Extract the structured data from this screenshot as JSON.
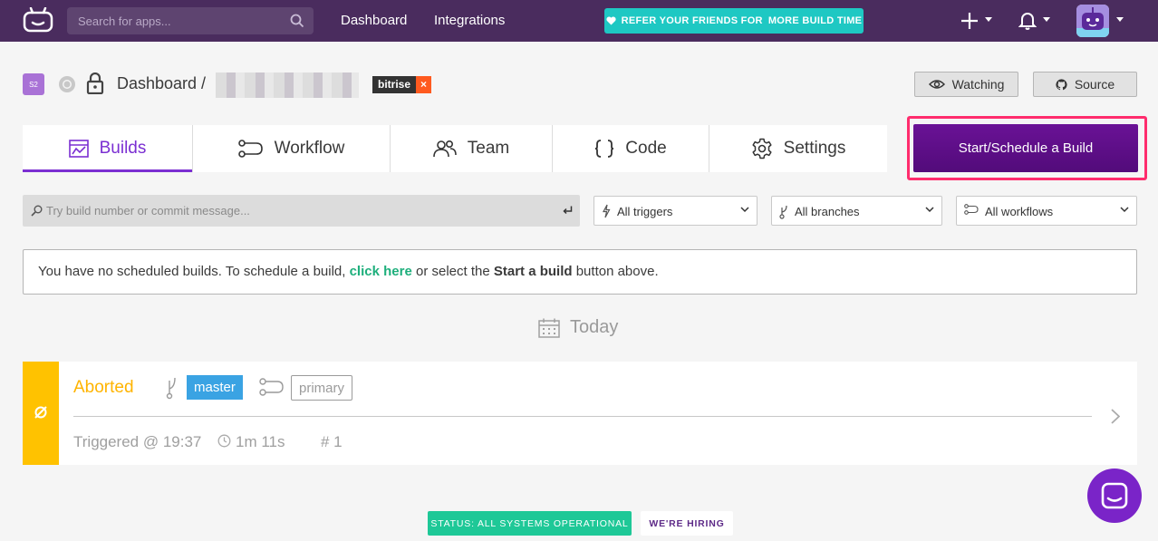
{
  "topnav": {
    "search_placeholder": "Search for apps...",
    "links": [
      "Dashboard",
      "Integrations"
    ],
    "refer_prefix": "REFER YOUR FRIENDS FOR",
    "refer_strong": "MORE BUILD TIME"
  },
  "header": {
    "app_badge": "S2",
    "crumb": "Dashboard /",
    "tag_name": "bitrise",
    "tag_remove": "×",
    "watching_label": "Watching",
    "source_label": "Source"
  },
  "tabs": [
    {
      "label": "Builds",
      "icon": "builds-icon",
      "active": true
    },
    {
      "label": "Workflow",
      "icon": "workflow-icon",
      "active": false
    },
    {
      "label": "Team",
      "icon": "team-icon",
      "active": false
    },
    {
      "label": "Code",
      "icon": "code-icon",
      "active": false
    },
    {
      "label": "Settings",
      "icon": "gear-icon",
      "active": false
    }
  ],
  "start_button": "Start/Schedule a Build",
  "filters": {
    "search_placeholder": "Try build number or commit message...",
    "triggers": "All triggers",
    "branches": "All branches",
    "workflows": "All workflows"
  },
  "info": {
    "text_before": "You have no scheduled builds. To schedule a build, ",
    "link": "click here",
    "text_middle": " or select the ",
    "strong": "Start a build",
    "text_after": " button above."
  },
  "today_label": "Today",
  "build": {
    "status": "Aborted",
    "branch": "master",
    "workflow": "primary",
    "triggered": "Triggered @ 19:37",
    "duration": "1m 11s",
    "number": "# 1"
  },
  "footer": {
    "status": "STATUS: ALL SYSTEMS OPERATIONAL",
    "hiring": "WE'RE HIRING"
  },
  "colors": {
    "nav_bg": "#4a2c5e",
    "accent": "#7b2fd2",
    "start_button": "#5e0f8a",
    "highlight_border": "#ff2c6d",
    "aborted": "#ffc200",
    "branch_tag": "#3aa3e3",
    "link_green": "#1eaf7c",
    "status_green": "#1ec897"
  }
}
